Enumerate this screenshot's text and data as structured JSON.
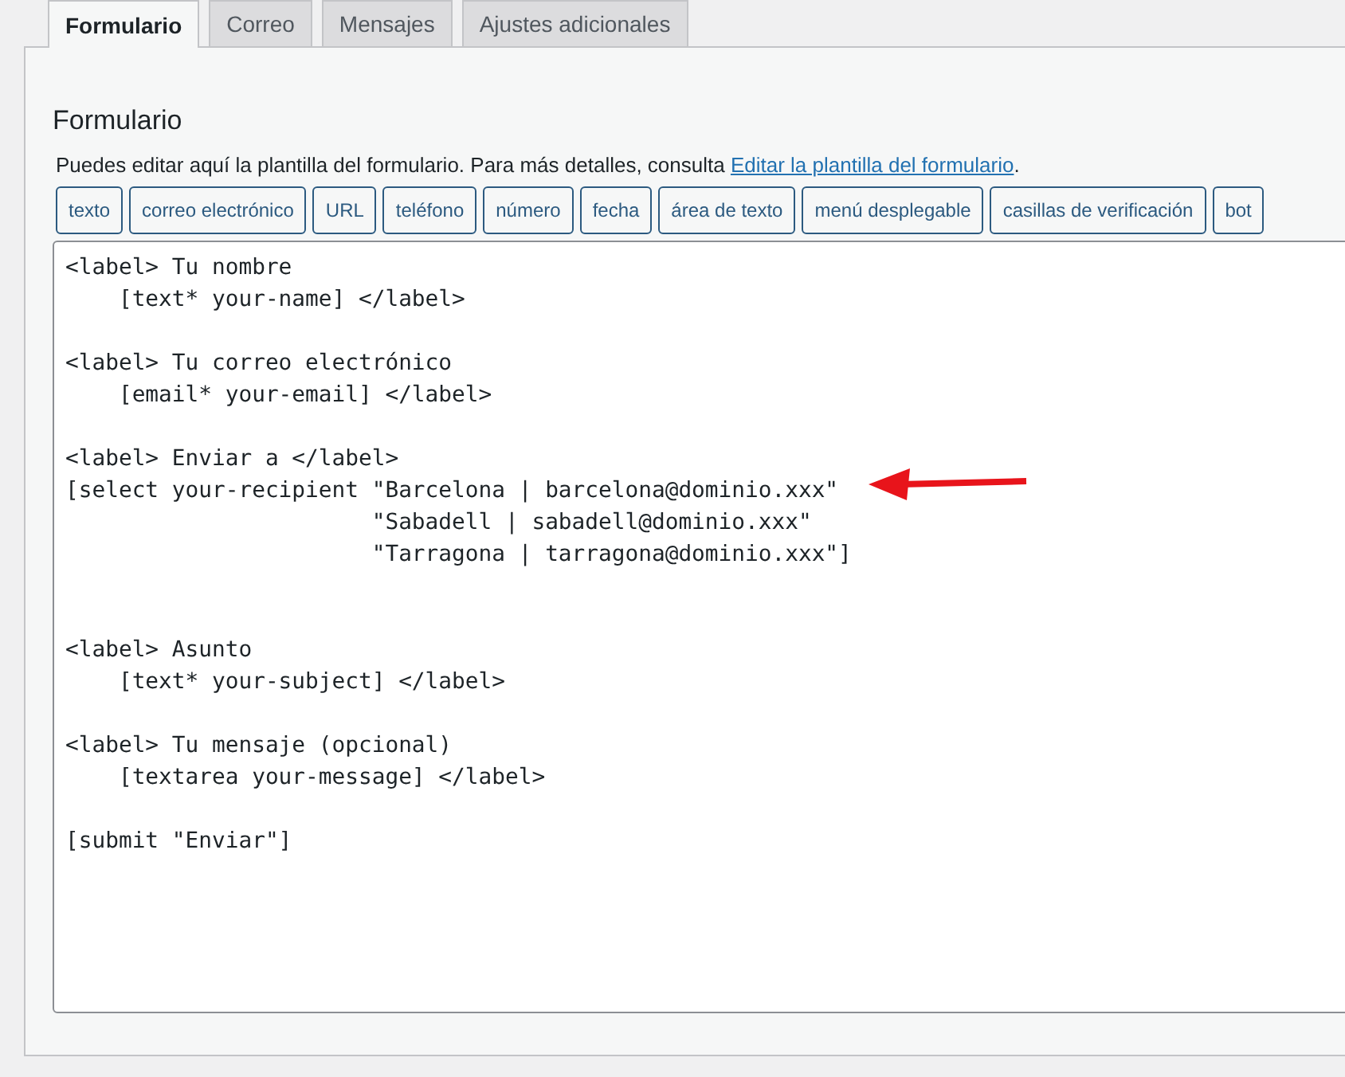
{
  "tabs": [
    {
      "label": "Formulario",
      "selected": true
    },
    {
      "label": "Correo",
      "selected": false
    },
    {
      "label": "Mensajes",
      "selected": false
    },
    {
      "label": "Ajustes adicionales",
      "selected": false
    }
  ],
  "panel": {
    "heading": "Formulario",
    "description": "Puedes editar aquí la plantilla del formulario. Para más detalles, consulta ",
    "link": "Editar la plantilla del formulario",
    "description_end": "."
  },
  "tag_buttons": [
    "texto",
    "correo electrónico",
    "URL",
    "teléfono",
    "número",
    "fecha",
    "área de texto",
    "menú desplegable",
    "casillas de verificación",
    "bot"
  ],
  "editor": {
    "value": "<label> Tu nombre\n    [text* your-name] </label>\n\n<label> Tu correo electrónico\n    [email* your-email] </label>\n\n<label> Enviar a </label>\n[select your-recipient \"Barcelona | barcelona@dominio.xxx\"\n                       \"Sabadell | sabadell@dominio.xxx\"\n                       \"Tarragona | tarragona@dominio.xxx\"]\n\n\n<label> Asunto\n    [text* your-subject] </label>\n\n<label> Tu mensaje (opcional)\n    [textarea your-message] </label>\n\n[submit \"Enviar\"]"
  }
}
